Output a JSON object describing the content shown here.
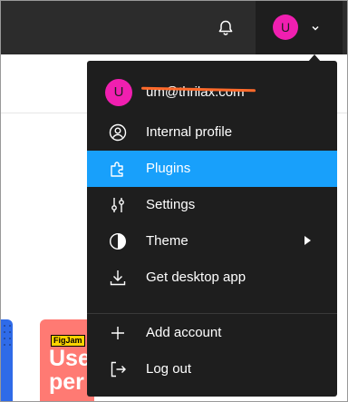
{
  "topbar": {
    "avatar_initial": "U",
    "bell_icon": "bell-icon",
    "chevron_icon": "chevron-down-icon"
  },
  "background_card": {
    "tag": "FigJam",
    "text_lines": [
      "Use",
      "per"
    ]
  },
  "menu": {
    "account": {
      "avatar_initial": "U",
      "email": "um@thrilax.com",
      "avatar_color": "#f01fb0"
    },
    "items": [
      {
        "label": "Internal profile",
        "icon": "user-circle-icon",
        "active": false
      },
      {
        "label": "Plugins",
        "icon": "plugin-icon",
        "active": true
      },
      {
        "label": "Settings",
        "icon": "sliders-icon",
        "active": false
      },
      {
        "label": "Theme",
        "icon": "theme-icon",
        "active": false,
        "has_submenu": true
      },
      {
        "label": "Get desktop app",
        "icon": "download-icon",
        "active": false
      }
    ],
    "secondary": [
      {
        "label": "Add account",
        "icon": "plus-icon"
      },
      {
        "label": "Log out",
        "icon": "logout-icon"
      }
    ]
  },
  "colors": {
    "accent": "#18a0fb",
    "menu_bg": "#1e1e1e",
    "topbar_bg": "#2c2c2c"
  }
}
